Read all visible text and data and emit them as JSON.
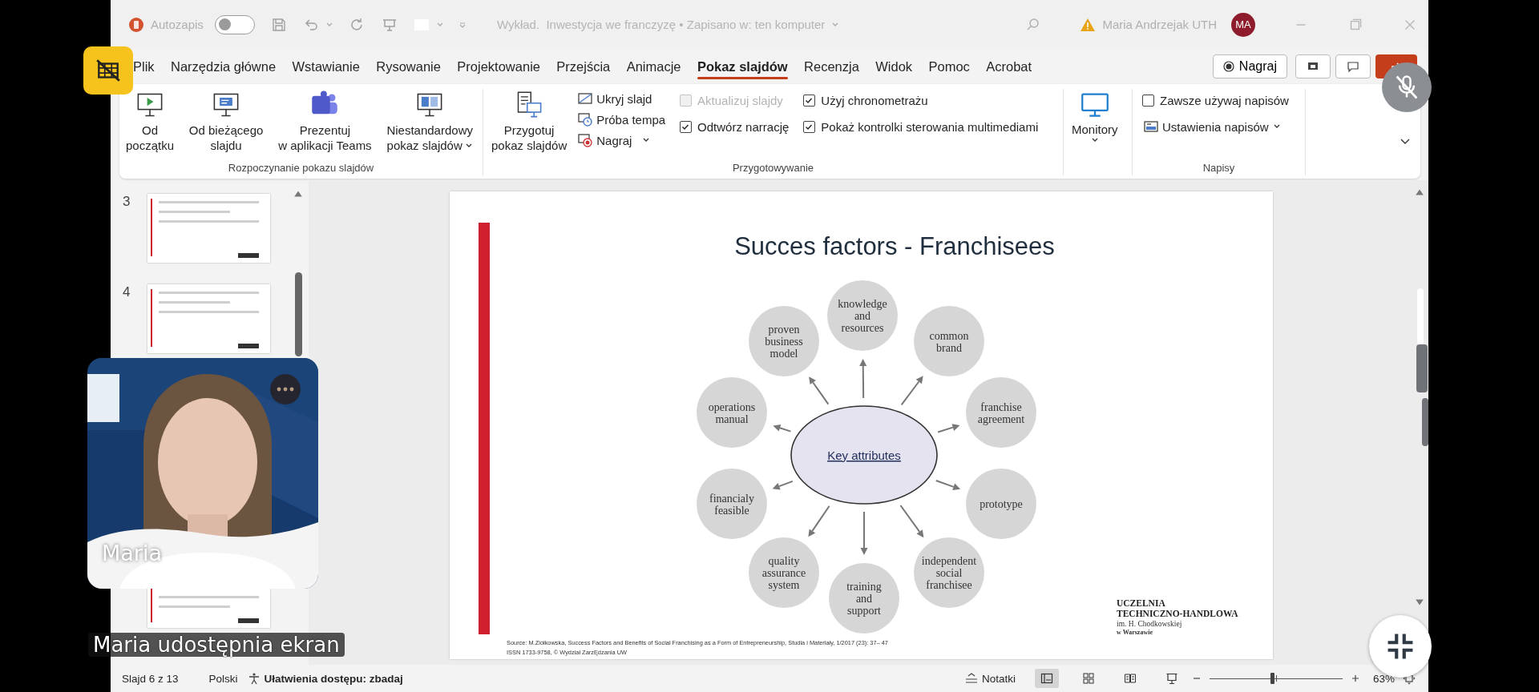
{
  "title_bar": {
    "autosave_label": "Autozapis",
    "autosave_on": false,
    "document_title": "Wykład.  Inwestycja we franczyzę • Zapisano w: ten komputer",
    "user_name": "Maria Andrzejak UTH",
    "user_initials": "MA"
  },
  "menu_tabs": [
    {
      "label": "Plik",
      "selected": false
    },
    {
      "label": "Narzędzia główne",
      "selected": false
    },
    {
      "label": "Wstawianie",
      "selected": false
    },
    {
      "label": "Rysowanie",
      "selected": false
    },
    {
      "label": "Projektowanie",
      "selected": false
    },
    {
      "label": "Przejścia",
      "selected": false
    },
    {
      "label": "Animacje",
      "selected": false
    },
    {
      "label": "Pokaz slajdów",
      "selected": true
    },
    {
      "label": "Recenzja",
      "selected": false
    },
    {
      "label": "Widok",
      "selected": false
    },
    {
      "label": "Pomoc",
      "selected": false
    },
    {
      "label": "Acrobat",
      "selected": false
    }
  ],
  "record_button": "Nagraj",
  "ribbon": {
    "start_group": {
      "label": "Rozpoczynanie pokazu slajdów",
      "buttons": [
        {
          "lines": [
            "Od",
            "początku"
          ],
          "dropdown": false
        },
        {
          "lines": [
            "Od bieżącego",
            "slajdu"
          ],
          "dropdown": false
        },
        {
          "lines": [
            "Prezentuj",
            "w aplikacji Teams"
          ],
          "dropdown": false
        },
        {
          "lines": [
            "Niestandardowy",
            "pokaz slajdów"
          ],
          "dropdown": true
        }
      ]
    },
    "setup_group": {
      "label": "Przygotowywanie",
      "setup_button": [
        "Przygotuj",
        "pokaz slajdów"
      ],
      "small_buttons": [
        {
          "label": "Ukryj slajd",
          "dropdown": false
        },
        {
          "label": "Próba tempa",
          "dropdown": false
        },
        {
          "label": "Nagraj",
          "dropdown": true
        }
      ],
      "checkboxes": [
        {
          "label": "Aktualizuj slajdy",
          "checked": false,
          "disabled": true
        },
        {
          "label": "Użyj chronometrażu",
          "checked": true,
          "disabled": false
        },
        {
          "label": "Odtwórz narrację",
          "checked": true,
          "disabled": false
        },
        {
          "label": "Pokaż kontrolki sterowania multimediami",
          "checked": true,
          "disabled": false
        }
      ]
    },
    "monitors_button": "Monitory",
    "captions_group": {
      "label": "Napisy",
      "checkbox": {
        "label": "Zawsze używaj napisów",
        "checked": false
      },
      "settings_button": "Ustawienia napisów"
    }
  },
  "thumbnails": [
    {
      "number": "3"
    },
    {
      "number": "4"
    }
  ],
  "slide": {
    "title": "Succes factors - Franchisees",
    "center": "Key attributes",
    "attributes": [
      "knowledge and resources",
      "proven business model",
      "common brand",
      "operations manual",
      "franchise agreement",
      "financialy feasible",
      "prototype",
      "quality assurance system",
      "independent social franchisee",
      "training and support"
    ],
    "source_lines": [
      "Source: M.Ziółkowska, Success Factors and Benefits of Social Franchising as a Form of Entrepreneurship, Studia i Materiały, 1/2017 (23): 37– 47",
      "ISSN 1733-9758, © Wydział ZarzĘdzania UW"
    ],
    "logo_lines": [
      "UCZELNIA",
      "TECHNICZNO-HANDLOWA",
      "im. H. Chodkowskiej",
      "w Warszawie"
    ]
  },
  "status_bar": {
    "slide_counter": "Slajd 6 z 13",
    "language": "Polski",
    "accessibility": "Ułatwienia dostępu: zbadaj",
    "notes": "Notatki",
    "views": [
      {
        "selected": true
      },
      {
        "selected": false
      },
      {
        "selected": false
      },
      {
        "selected": false
      }
    ],
    "zoom": {
      "level": 0.47
    },
    "zoom_reading": "63%"
  },
  "video_tile": {
    "name": "Maria"
  },
  "share_caption": "Maria udostępnia ekran"
}
